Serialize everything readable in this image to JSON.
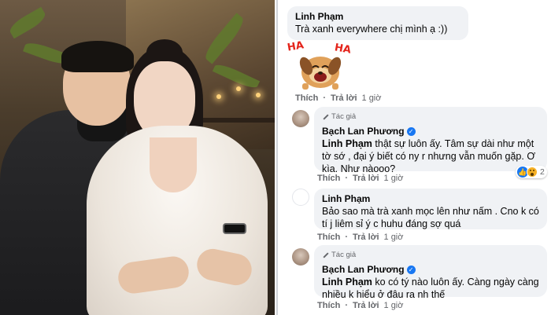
{
  "photo": {
    "description_icon": "couple-photo"
  },
  "comments": [
    {
      "author": "Linh Phạm",
      "text": "Trà xanh everywhere chị mình ạ :))",
      "sticker": {
        "label_left": "HA",
        "label_right": "HA",
        "icon": "laughing-dog-sticker"
      },
      "actions": {
        "like": "Thích",
        "reply": "Trả lời",
        "time": "1 giờ"
      }
    },
    {
      "badge": "Tác giả",
      "author": "Bạch Lan Phương",
      "verified": true,
      "mention": "Linh Phạm",
      "text": "thật sự luôn ấy. Tâm sự dài như một tờ sớ , đại ý biết có ny r nhưng vẫn muốn gặp. Ơ kìa. Như nàooo?",
      "reactions": {
        "count": "2",
        "types": [
          "like",
          "wow"
        ]
      },
      "actions": {
        "like": "Thích",
        "reply": "Trả lời",
        "time": "1 giờ"
      }
    },
    {
      "author": "Linh Phạm",
      "text": "Bảo sao mà trà xanh mọc lên như nấm . Cno k có tí j liêm sỉ ý c huhu đáng sợ quá",
      "actions": {
        "like": "Thích",
        "reply": "Trả lời",
        "time": "1 giờ"
      }
    },
    {
      "badge": "Tác giả",
      "author": "Bạch Lan Phương",
      "verified": true,
      "mention": "Linh Phạm",
      "text": "ko có tý nào luôn ấy. Càng ngày càng nhiều k hiểu ở đâu ra nh thế",
      "actions": {
        "like": "Thích",
        "reply": "Trả lời",
        "time": "1 giờ"
      }
    }
  ]
}
